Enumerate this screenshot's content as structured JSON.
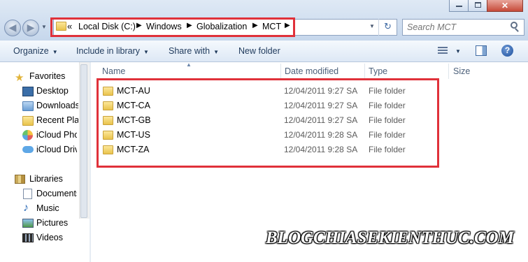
{
  "breadcrumb": {
    "overflow": "«",
    "items": [
      "Local Disk (C:)",
      "Windows",
      "Globalization",
      "MCT"
    ]
  },
  "search": {
    "placeholder": "Search MCT"
  },
  "toolbar": {
    "organize": "Organize",
    "include_in_library": "Include in library",
    "share_with": "Share with",
    "new_folder": "New folder"
  },
  "nav": {
    "favorites": {
      "label": "Favorites",
      "items": [
        "Desktop",
        "Downloads",
        "Recent Places",
        "iCloud Photos",
        "iCloud Drive"
      ]
    },
    "libraries": {
      "label": "Libraries",
      "items": [
        "Documents",
        "Music",
        "Pictures",
        "Videos"
      ]
    }
  },
  "columns": {
    "name": "Name",
    "date": "Date modified",
    "type": "Type",
    "size": "Size"
  },
  "rows": [
    {
      "name": "MCT-AU",
      "date": "12/04/2011 9:27 SA",
      "type": "File folder"
    },
    {
      "name": "MCT-CA",
      "date": "12/04/2011 9:27 SA",
      "type": "File folder"
    },
    {
      "name": "MCT-GB",
      "date": "12/04/2011 9:27 SA",
      "type": "File folder"
    },
    {
      "name": "MCT-US",
      "date": "12/04/2011 9:28 SA",
      "type": "File folder"
    },
    {
      "name": "MCT-ZA",
      "date": "12/04/2011 9:28 SA",
      "type": "File folder"
    }
  ],
  "watermark": "BLOGCHIASEKIENTHUC.COM",
  "colors": {
    "highlight": "#e0313a",
    "header_bg": "#dfe9f5"
  }
}
